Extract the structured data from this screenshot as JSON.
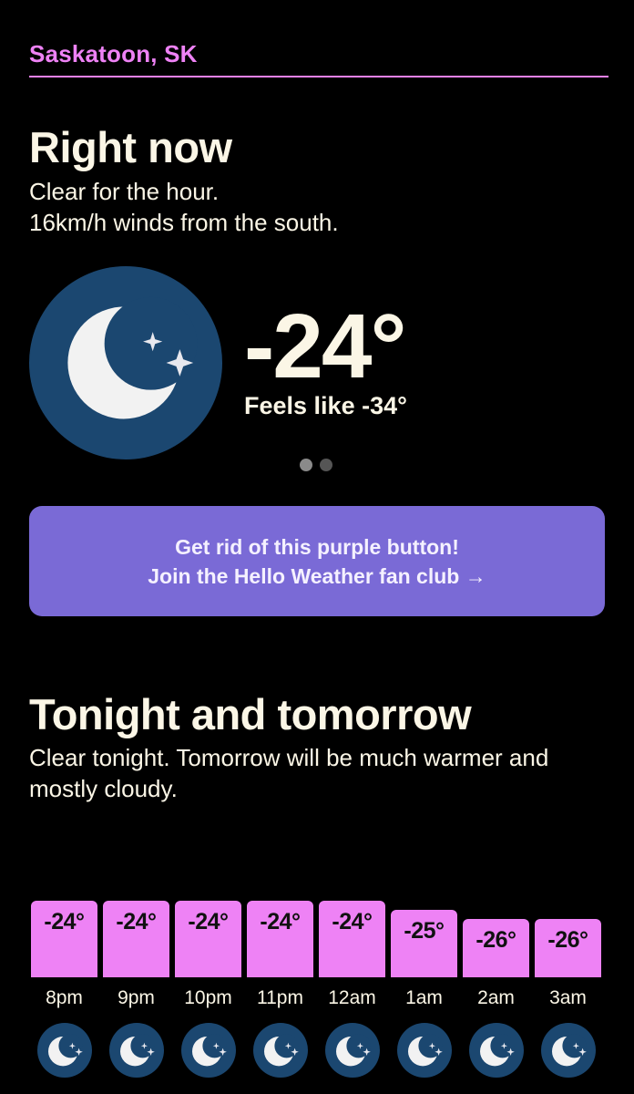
{
  "header": {
    "location": "Saskatoon, SK",
    "accent_color": "#ee82f5"
  },
  "right_now": {
    "title": "Right now",
    "summary_line1": "Clear for the hour.",
    "summary_line2": "16km/h winds from the south.",
    "icon": "clear-night-moon-icon",
    "temperature": "-24°",
    "feels_like": "Feels like -34°",
    "pager": {
      "pages": 2,
      "active": 1
    }
  },
  "promo": {
    "line1": "Get rid of this purple button!",
    "line2": "Join the Hello Weather fan club →",
    "color": "#7a6ad6"
  },
  "tonight": {
    "title": "Tonight and tomorrow",
    "summary": "Clear tonight. Tomorrow will be much warmer and mostly cloudy."
  },
  "hourly": [
    {
      "time": "8pm",
      "temp": "-24°",
      "value": -24,
      "icon": "clear-night-moon-icon"
    },
    {
      "time": "9pm",
      "temp": "-24°",
      "value": -24,
      "icon": "clear-night-moon-icon"
    },
    {
      "time": "10pm",
      "temp": "-24°",
      "value": -24,
      "icon": "clear-night-moon-icon"
    },
    {
      "time": "11pm",
      "temp": "-24°",
      "value": -24,
      "icon": "clear-night-moon-icon"
    },
    {
      "time": "12am",
      "temp": "-24°",
      "value": -24,
      "icon": "clear-night-moon-icon"
    },
    {
      "time": "1am",
      "temp": "-25°",
      "value": -25,
      "icon": "clear-night-moon-icon"
    },
    {
      "time": "2am",
      "temp": "-26°",
      "value": -26,
      "icon": "clear-night-moon-icon"
    },
    {
      "time": "3am",
      "temp": "-26°",
      "value": -26,
      "icon": "clear-night-moon-icon"
    }
  ],
  "colors": {
    "background": "#000000",
    "text": "#fbf6e6",
    "icon_circle": "#1b4770",
    "moon": "#f2f2f2",
    "bar": "#ee82f5"
  }
}
